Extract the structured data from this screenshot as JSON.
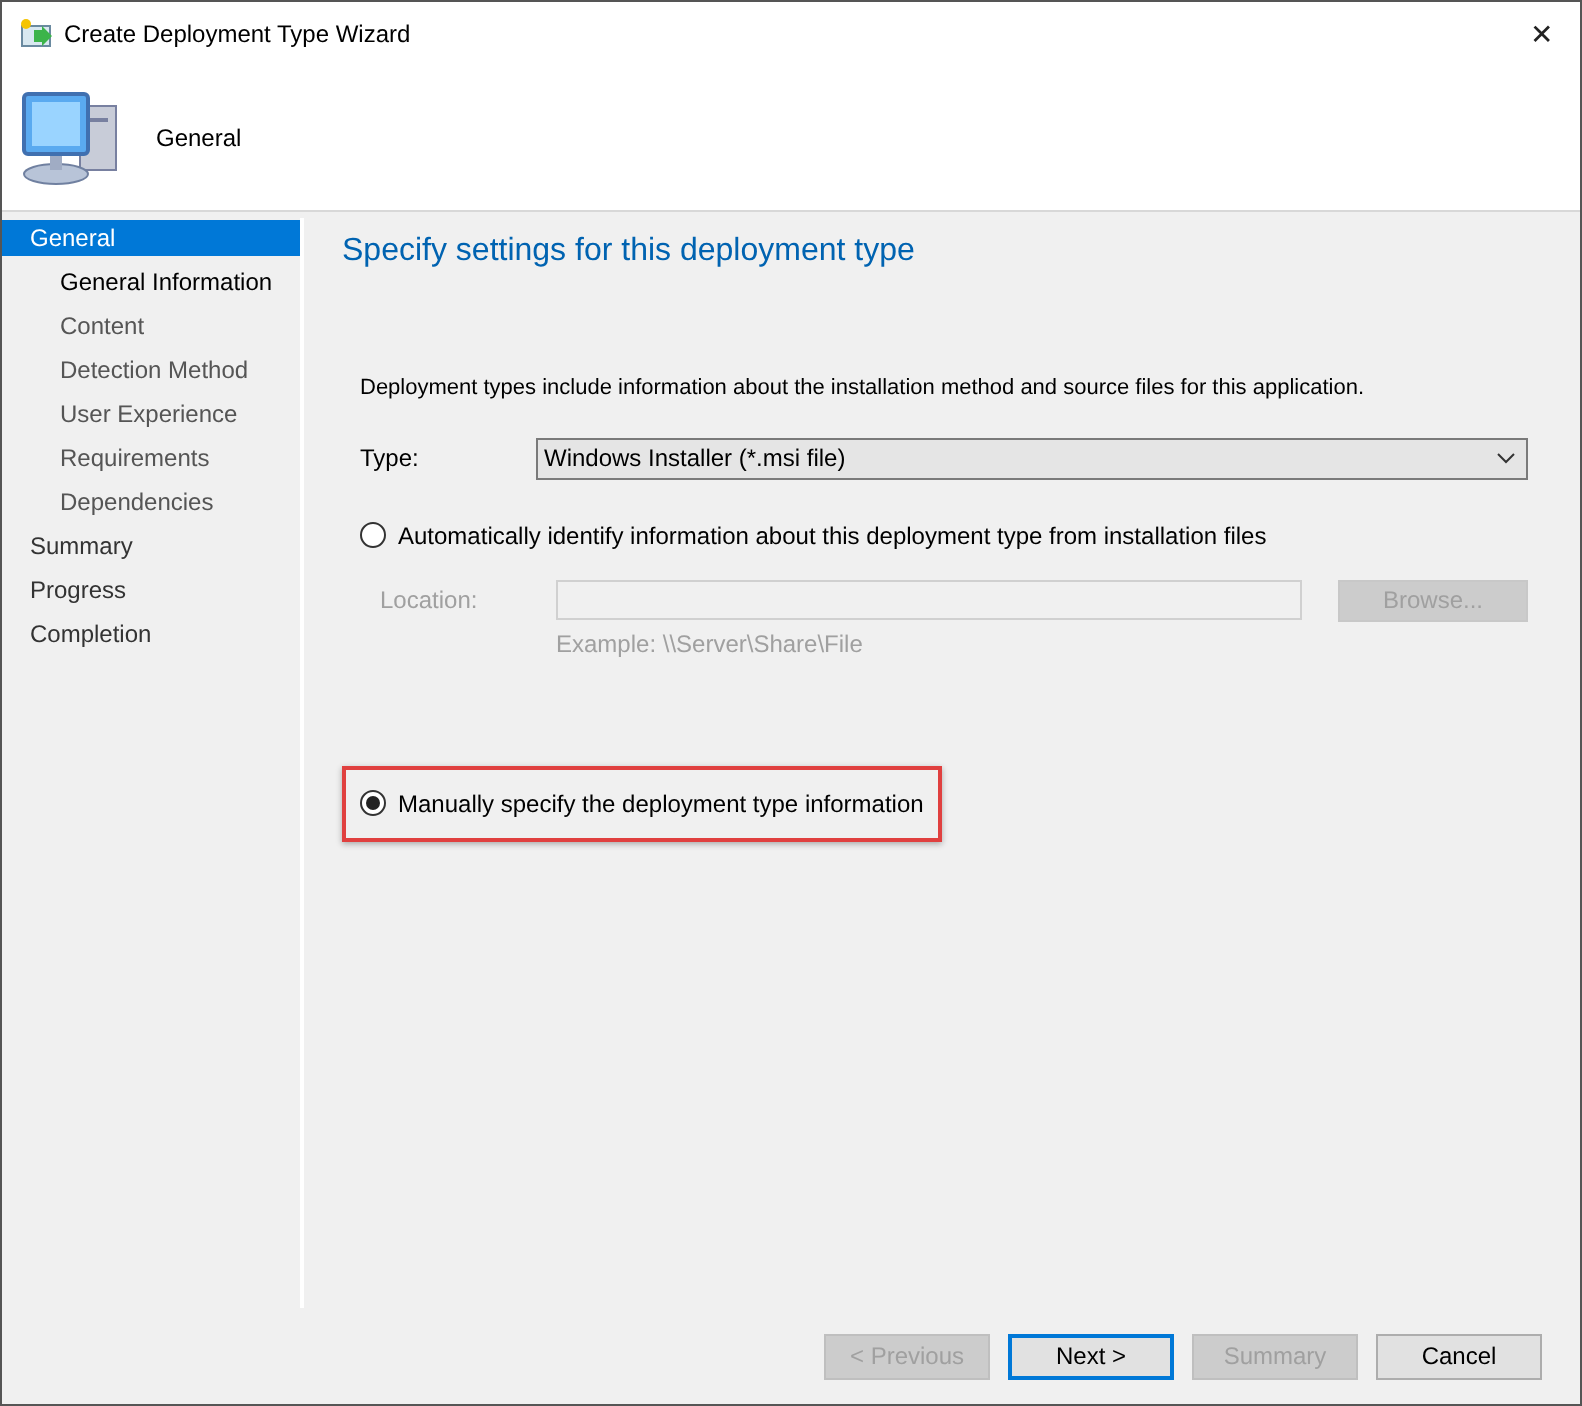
{
  "window": {
    "title": "Create Deployment Type Wizard",
    "close": "✕"
  },
  "header": {
    "title": "General"
  },
  "sidebar": {
    "items": [
      {
        "label": "General",
        "selected": true,
        "children": [
          {
            "label": "General Information",
            "current": true
          },
          {
            "label": "Content",
            "current": false
          },
          {
            "label": "Detection Method",
            "current": false
          },
          {
            "label": "User Experience",
            "current": false
          },
          {
            "label": "Requirements",
            "current": false
          },
          {
            "label": "Dependencies",
            "current": false
          }
        ]
      },
      {
        "label": "Summary",
        "selected": false
      },
      {
        "label": "Progress",
        "selected": false
      },
      {
        "label": "Completion",
        "selected": false
      }
    ]
  },
  "content": {
    "heading": "Specify settings for this deployment type",
    "description": "Deployment types include information about the installation method and source files for this application.",
    "type_label": "Type:",
    "type_value": "Windows Installer (*.msi file)",
    "options": [
      {
        "label": "Automatically identify information about this deployment type from installation files",
        "selected": false,
        "highlighted": false
      },
      {
        "label": "Manually specify the deployment type information",
        "selected": true,
        "highlighted": true
      }
    ],
    "location": {
      "label": "Location:",
      "disabled": true,
      "button": "Browse...",
      "example": "Example: \\\\Server\\Share\\File"
    }
  },
  "buttons": [
    {
      "label": "< Previous",
      "disabled": true,
      "default": false
    },
    {
      "label": "Next >",
      "disabled": false,
      "default": true
    },
    {
      "label": "Summary",
      "disabled": true,
      "default": false
    },
    {
      "label": "Cancel",
      "disabled": false,
      "default": false
    }
  ]
}
